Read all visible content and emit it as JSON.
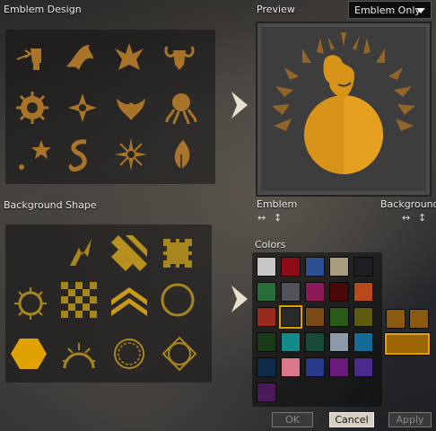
{
  "emblem_section": {
    "title": "Emblem Design"
  },
  "background_section": {
    "title": "Background Shape"
  },
  "preview_section": {
    "title": "Preview",
    "mode_dropdown": "Emblem Only",
    "emblem_label": "Emblem",
    "background_label": "Background",
    "flip_h_glyph": "↔",
    "flip_v_glyph": "↕"
  },
  "colors_section": {
    "title": "Colors"
  },
  "buttons": {
    "ok": "OK",
    "cancel": "Cancel",
    "apply": "Apply"
  },
  "palette": [
    [
      "#c8c8c8",
      "#8e0c18",
      "#2e4f92",
      "#a99d7f",
      "#1e1e22"
    ],
    [
      "#2a6b3a",
      "#505458",
      "#8a1a58",
      "#4a0808",
      "#b84a1a"
    ],
    [
      "#9a2a1e",
      "#2a2a2a",
      "#7a4a14",
      "#2a5a18",
      "#5e5a10"
    ],
    [
      "#1a3a18",
      "#128a8a",
      "#164a3a",
      "#8a9aa8",
      "#156a96"
    ],
    [
      "#102a4a",
      "#d87888",
      "#2a3a8a",
      "#6a1a7a",
      "#4a2a8a"
    ],
    [
      "#4a1a5a"
    ]
  ],
  "selected_colors": {
    "emblem": "#8a5a10",
    "background": "#9a6400"
  },
  "accent_gold": "#e0a200"
}
